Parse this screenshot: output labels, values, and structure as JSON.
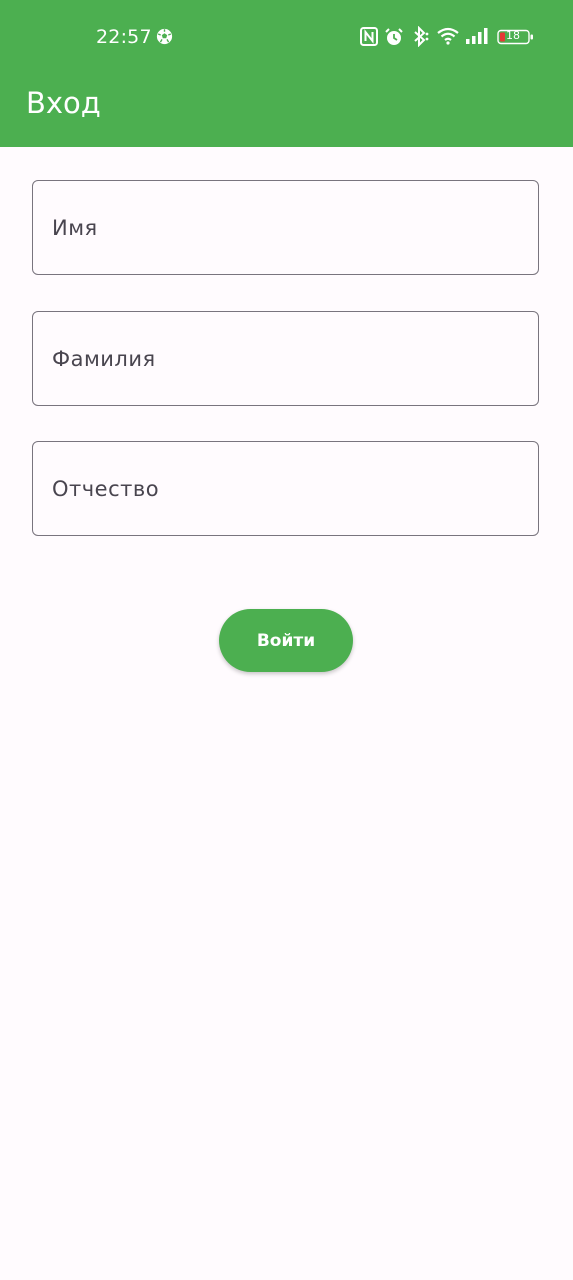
{
  "status_bar": {
    "time": "22:57",
    "battery_level": "18",
    "icons": [
      "soccer-ball-icon",
      "nfc-icon",
      "alarm-icon",
      "bluetooth-icon",
      "wifi-icon",
      "signal-icon",
      "battery-icon"
    ]
  },
  "app_bar": {
    "title": "Вход"
  },
  "form": {
    "first_name_label": "Имя",
    "last_name_label": "Фамилия",
    "patronymic_label": "Отчество",
    "submit_label": "Войти"
  },
  "colors": {
    "primary": "#4caf50",
    "background": "#fffbfe",
    "field_border": "#79747e",
    "field_label": "#49454f",
    "battery_low": "#e53935"
  }
}
